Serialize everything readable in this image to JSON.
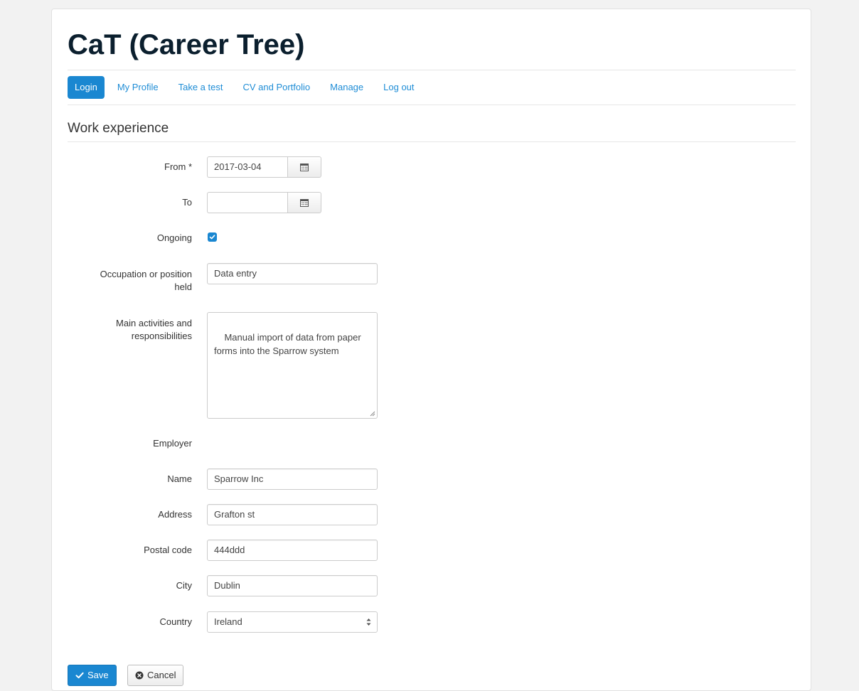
{
  "site": {
    "title": "CaT (Career Tree)"
  },
  "nav": {
    "items": [
      {
        "label": "Login",
        "active": true
      },
      {
        "label": "My Profile"
      },
      {
        "label": "Take a test"
      },
      {
        "label": "CV and Portfolio"
      },
      {
        "label": "Manage"
      },
      {
        "label": "Log out"
      }
    ]
  },
  "section": {
    "title": "Work experience"
  },
  "form": {
    "from": {
      "label": "From *",
      "value": "2017-03-04",
      "icon": "calendar-icon"
    },
    "to": {
      "label": "To",
      "value": "",
      "icon": "calendar-icon"
    },
    "ongoing": {
      "label": "Ongoing",
      "checked": true
    },
    "occupation": {
      "label_line1": "Occupation or position",
      "label_line2": "held",
      "value": "Data entry"
    },
    "activities": {
      "label_line1": "Main activities and",
      "label_line2": "responsibilities",
      "value": "Manual import of data from paper forms into the Sparrow system"
    },
    "employer": {
      "label": "Employer"
    },
    "name": {
      "label": "Name",
      "value": "Sparrow Inc"
    },
    "address": {
      "label": "Address",
      "value": "Grafton st"
    },
    "postal_code": {
      "label": "Postal code",
      "value": "444ddd"
    },
    "city": {
      "label": "City",
      "value": "Dublin"
    },
    "country": {
      "label": "Country",
      "value": "Ireland"
    }
  },
  "actions": {
    "save_label": "Save",
    "cancel_label": "Cancel"
  },
  "colors": {
    "primary": "#1a87d1",
    "link": "#1f8dd6",
    "title": "#0b1f2e"
  }
}
